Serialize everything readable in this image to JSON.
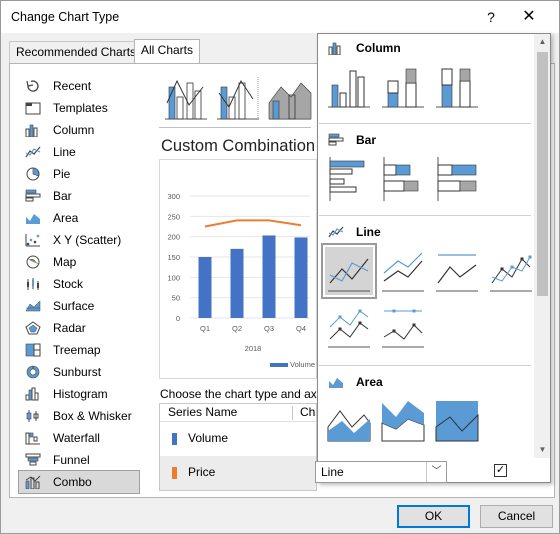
{
  "window": {
    "title": "Change Chart Type",
    "help": "?",
    "close": "✕"
  },
  "tabs": [
    {
      "label": "Recommended Charts"
    },
    {
      "label": "All Charts"
    }
  ],
  "chart_types": [
    {
      "label": "Recent",
      "icon": "recent-icon"
    },
    {
      "label": "Templates",
      "icon": "templates-icon"
    },
    {
      "label": "Column",
      "icon": "column-chart-icon"
    },
    {
      "label": "Line",
      "icon": "line-chart-icon"
    },
    {
      "label": "Pie",
      "icon": "pie-chart-icon"
    },
    {
      "label": "Bar",
      "icon": "bar-chart-icon"
    },
    {
      "label": "Area",
      "icon": "area-chart-icon"
    },
    {
      "label": "X Y (Scatter)",
      "icon": "scatter-chart-icon"
    },
    {
      "label": "Map",
      "icon": "map-chart-icon"
    },
    {
      "label": "Stock",
      "icon": "stock-chart-icon"
    },
    {
      "label": "Surface",
      "icon": "surface-chart-icon"
    },
    {
      "label": "Radar",
      "icon": "radar-chart-icon"
    },
    {
      "label": "Treemap",
      "icon": "treemap-chart-icon"
    },
    {
      "label": "Sunburst",
      "icon": "sunburst-chart-icon"
    },
    {
      "label": "Histogram",
      "icon": "histogram-chart-icon"
    },
    {
      "label": "Box & Whisker",
      "icon": "box-whisker-chart-icon"
    },
    {
      "label": "Waterfall",
      "icon": "waterfall-chart-icon"
    },
    {
      "label": "Funnel",
      "icon": "funnel-chart-icon"
    },
    {
      "label": "Combo",
      "icon": "combo-chart-icon",
      "selected": true
    }
  ],
  "main": {
    "subtype_title": "Custom Combination",
    "instruction": "Choose the chart type and axis",
    "series_header": {
      "name": "Series Name",
      "type": "Cha"
    },
    "series": [
      {
        "name": "Volume",
        "color": "#4472c4"
      },
      {
        "name": "Price",
        "color": "#ed7d31",
        "chart_type": "Line",
        "secondary_axis": true
      }
    ]
  },
  "chart_data": {
    "type": "bar",
    "categories": [
      "Q1",
      "Q2",
      "Q3",
      "Q4"
    ],
    "category_group": "2018",
    "ylim": [
      0,
      300
    ],
    "yticks": [
      0,
      50,
      100,
      150,
      200,
      250,
      300
    ],
    "series": [
      {
        "name": "Volume",
        "type": "bar",
        "values": [
          150,
          170,
          203,
          198
        ],
        "color": "#4472c4"
      },
      {
        "type": "line",
        "values": [
          225,
          240,
          240,
          228
        ],
        "color": "#ed7d31"
      }
    ],
    "legend": "Volume",
    "legend_position": "bottom"
  },
  "popup": {
    "groups": [
      {
        "label": "Column",
        "icon": "column-chart-icon",
        "thumbs": [
          "clustered-column-icon",
          "stacked-column-icon",
          "100-stacked-column-icon"
        ]
      },
      {
        "label": "Bar",
        "icon": "bar-chart-icon",
        "thumbs": [
          "clustered-bar-icon",
          "stacked-bar-icon",
          "100-stacked-bar-icon"
        ]
      },
      {
        "label": "Line",
        "icon": "line-chart-icon",
        "thumbs": [
          "line-icon",
          "stacked-line-icon",
          "100-stacked-line-icon",
          "line-with-markers-icon",
          "stacked-line-with-markers-icon",
          "100-stacked-line-with-markers-icon"
        ],
        "selected": 0
      },
      {
        "label": "Area",
        "icon": "area-chart-icon",
        "thumbs": [
          "area-icon",
          "stacked-area-icon",
          "100-stacked-area-icon"
        ]
      }
    ]
  },
  "footer": {
    "ok": "OK",
    "cancel": "Cancel"
  },
  "colors": {
    "accent": "#0078d7",
    "blue": "#4472c4",
    "orange": "#ed7d31"
  }
}
